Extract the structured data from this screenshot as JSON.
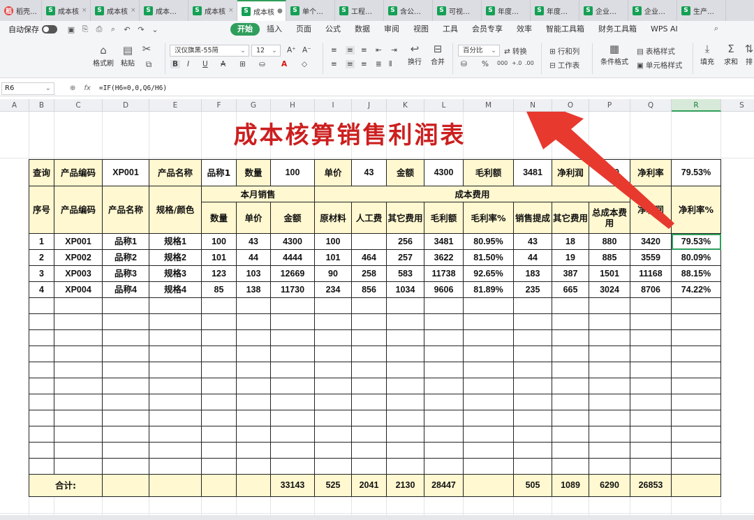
{
  "tabs": [
    {
      "label": "稻壳AI格",
      "icon": "docer-icon",
      "closable": false
    },
    {
      "label": "成本核",
      "icon": "sheet-icon",
      "closable": true
    },
    {
      "label": "成本核",
      "icon": "sheet-icon",
      "closable": true
    },
    {
      "label": "成本核算",
      "icon": "sheet-icon",
      "closable": false
    },
    {
      "label": "成本核",
      "icon": "sheet-icon",
      "closable": true
    },
    {
      "label": "成本核",
      "icon": "sheet-icon",
      "closable": true,
      "active": true
    },
    {
      "label": "单个产品",
      "icon": "sheet-icon",
      "closable": false
    },
    {
      "label": "工程项目",
      "icon": "sheet-icon",
      "closable": false
    },
    {
      "label": "含公式-全",
      "icon": "sheet-icon",
      "closable": false
    },
    {
      "label": "可视化月",
      "icon": "sheet-icon",
      "closable": false
    },
    {
      "label": "年度产品",
      "icon": "sheet-icon",
      "closable": false
    },
    {
      "label": "年度成本",
      "icon": "sheet-icon",
      "closable": false
    },
    {
      "label": "企业成本",
      "icon": "sheet-icon",
      "closable": false
    },
    {
      "label": "企业成本",
      "icon": "sheet-icon",
      "closable": false
    },
    {
      "label": "生产成本",
      "icon": "sheet-icon",
      "closable": false
    }
  ],
  "menubar": {
    "autosave": "自动保存",
    "tabs": [
      "开始",
      "插入",
      "页面",
      "公式",
      "数据",
      "审阅",
      "视图",
      "工具",
      "会员专享",
      "效率",
      "智能工具箱",
      "财务工具箱",
      "WPS AI"
    ],
    "active_tab": "开始"
  },
  "ribbon": {
    "format_painter": "格式刷",
    "paste": "粘贴",
    "font_name": "汉仪旗黑-55简",
    "font_size": "12",
    "number_format": "百分比",
    "convert": "转换",
    "wrap": "换行",
    "merge": "合并",
    "rows_cols": "行和列",
    "worksheet": "工作表",
    "cond_format": "条件格式",
    "table_style": "表格样式",
    "cell_style": "单元格样式",
    "fill": "填充",
    "sum": "求和",
    "sort": "排"
  },
  "formula_bar": {
    "cell_ref": "R6",
    "formula": "=IF(H6=0,0,Q6/H6)"
  },
  "columns": [
    "A",
    "B",
    "C",
    "D",
    "E",
    "F",
    "G",
    "H",
    "I",
    "J",
    "K",
    "L",
    "M",
    "N",
    "O",
    "P",
    "Q",
    "R",
    "S"
  ],
  "selected_column": "R",
  "sheet": {
    "title": "成本核算销售利润表",
    "query_row": {
      "label": "查询",
      "code_label": "产品编码",
      "code": "XP001",
      "name_label": "产品名称",
      "name": "品称1",
      "qty_label": "数量",
      "qty": "100",
      "price_label": "单价",
      "price": "43",
      "amount_label": "金额",
      "amount": "4300",
      "gross_label": "毛利额",
      "gross": "3481",
      "net_label": "净利润",
      "net": "3420",
      "rate_label": "净利率",
      "rate": "79.53%"
    },
    "header": {
      "seq": "序号",
      "code": "产品编码",
      "name": "产品名称",
      "spec": "规格/颜色",
      "sales_group": "本月销售",
      "qty": "数量",
      "price": "单价",
      "amount": "金额",
      "cost_group": "成本费用",
      "material": "原材料",
      "labor": "人工费",
      "other_cost": "其它费用",
      "gross": "毛利额",
      "gross_rate": "毛利率%",
      "sales_commission": "销售提成",
      "other_fee": "其它费用",
      "total_cost": "总成本费用",
      "net_profit": "净利润",
      "net_rate": "净利率%"
    },
    "rows": [
      [
        "1",
        "XP001",
        "品称1",
        "规格1",
        "100",
        "43",
        "4300",
        "100",
        "",
        "256",
        "3481",
        "80.95%",
        "43",
        "18",
        "880",
        "3420",
        "79.53%"
      ],
      [
        "2",
        "XP002",
        "品称2",
        "规格2",
        "101",
        "44",
        "4444",
        "101",
        "464",
        "257",
        "3622",
        "81.50%",
        "44",
        "19",
        "885",
        "3559",
        "80.09%"
      ],
      [
        "3",
        "XP003",
        "品称3",
        "规格3",
        "123",
        "103",
        "12669",
        "90",
        "258",
        "583",
        "11738",
        "92.65%",
        "183",
        "387",
        "1501",
        "11168",
        "88.15%"
      ],
      [
        "4",
        "XP004",
        "品称4",
        "规格4",
        "85",
        "138",
        "11730",
        "234",
        "856",
        "1034",
        "9606",
        "81.89%",
        "235",
        "665",
        "3024",
        "8706",
        "74.22%"
      ]
    ],
    "totals": {
      "label": "合计:",
      "values": [
        "",
        "",
        "",
        "",
        "33143",
        "525",
        "2041",
        "2130",
        "28447",
        "",
        "505",
        "1089",
        "6290",
        "26853",
        ""
      ]
    }
  }
}
